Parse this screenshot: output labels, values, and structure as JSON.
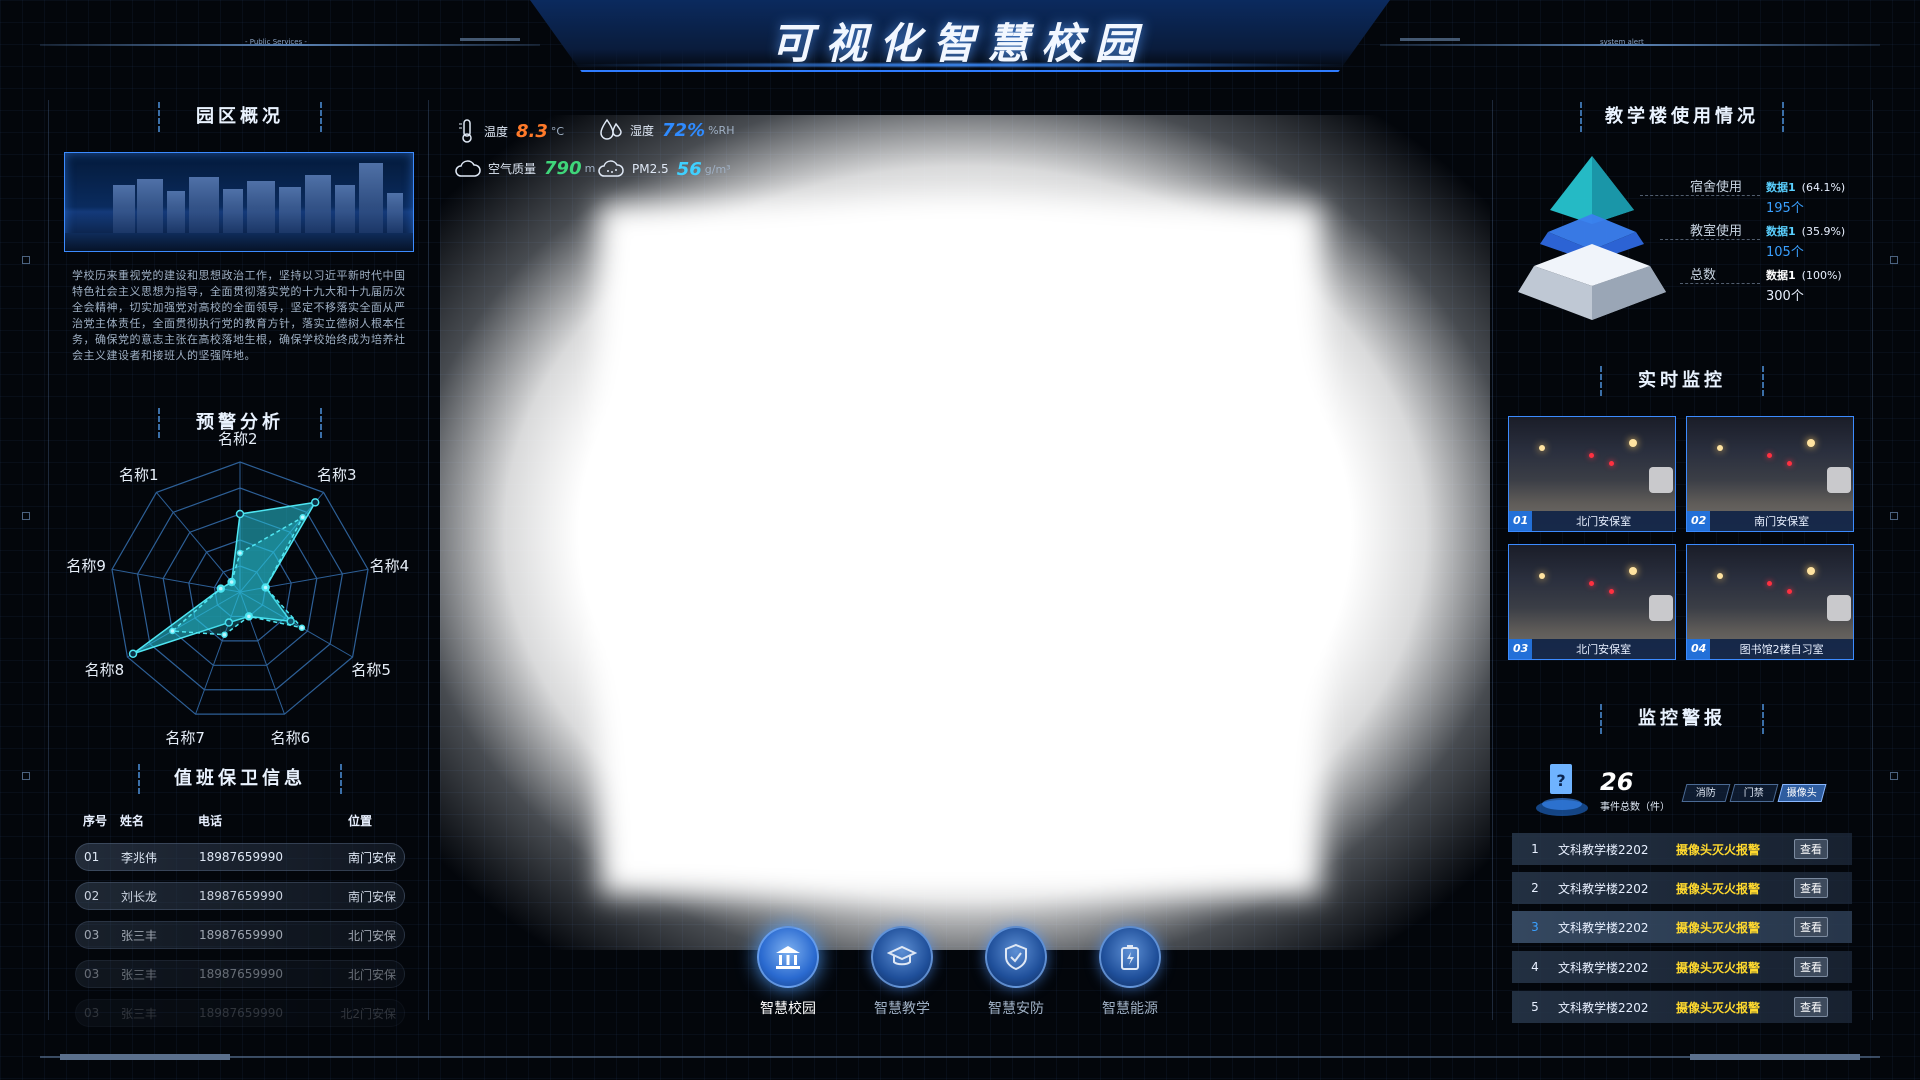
{
  "header": {
    "title": "可视化智慧校园",
    "deco_left": "- Public Services -",
    "deco_right": "system alert"
  },
  "left": {
    "overview_title": "园区概况",
    "overview_text": "学校历来重视党的建设和思想政治工作，坚持以习近平新时代中国特色社会主义思想为指导，全面贯彻落实党的十九大和十九届历次全会精神，切实加强党对高校的全面领导，坚定不移落实全面从严治党主体责任，全面贯彻执行党的教育方针，落实立德树人根本任务，确保党的意志主张在高校落地生根，确保学校始终成为培养社会主义建设者和接班人的坚强阵地。",
    "warning_title": "预警分析",
    "radar": {
      "labels": [
        "名称1",
        "名称2",
        "名称3",
        "名称4",
        "名称5",
        "名称6",
        "名称7",
        "名称8",
        "名称9"
      ],
      "series": [
        {
          "values": [
            0.1,
            0.6,
            0.9,
            0.2,
            0.45,
            0.2,
            0.25,
            0.95,
            0.15
          ]
        },
        {
          "values": [
            0.1,
            0.3,
            0.75,
            0.2,
            0.55,
            0.2,
            0.35,
            0.6,
            0.15
          ]
        }
      ]
    },
    "duty_title": "值班保卫信息",
    "duty_headers": [
      "序号",
      "姓名",
      "电话",
      "位置"
    ],
    "duty_rows": [
      [
        "01",
        "李兆伟",
        "18987659990",
        "南门安保"
      ],
      [
        "02",
        "刘长龙",
        "18987659990",
        "南门安保"
      ],
      [
        "03",
        "张三丰",
        "18987659990",
        "北门安保"
      ],
      [
        "03",
        "张三丰",
        "18987659990",
        "北门安保"
      ],
      [
        "03",
        "张三丰",
        "18987659990",
        "北2门安保"
      ]
    ]
  },
  "weather": {
    "temp": {
      "label": "温度",
      "value": "8.3",
      "unit": "°C",
      "color": "#ff7a2a"
    },
    "humidity": {
      "label": "湿度",
      "value": "72%",
      "unit": "%RH",
      "color": "#2f8bff"
    },
    "air": {
      "label": "空气质量",
      "value": "790",
      "unit": "m",
      "color": "#3fd67a"
    },
    "pm": {
      "label": "PM2.5",
      "value": "56",
      "unit": "g/m³",
      "color": "#3fd0ff"
    }
  },
  "nav": [
    {
      "label": "智慧校园",
      "icon": "bank-icon",
      "active": true
    },
    {
      "label": "智慧教学",
      "icon": "graduation-cap-icon",
      "active": false
    },
    {
      "label": "智慧安防",
      "icon": "shield-check-icon",
      "active": false
    },
    {
      "label": "智慧能源",
      "icon": "battery-icon",
      "active": false
    }
  ],
  "right": {
    "building_title": "教学楼使用情况",
    "pyramid": [
      {
        "label": "宿舍使用",
        "tag": "数据1",
        "pct": "(64.1%)",
        "count": "195个"
      },
      {
        "label": "教室使用",
        "tag": "数据1",
        "pct": "(35.9%)",
        "count": "105个"
      },
      {
        "label": "总数",
        "tag": "数据1",
        "pct": "(100%)",
        "count": "300个"
      }
    ],
    "monitor_title": "实时监控",
    "cameras": [
      {
        "num": "01",
        "name": "北门安保室"
      },
      {
        "num": "02",
        "name": "南门安保室"
      },
      {
        "num": "03",
        "name": "北门安保室"
      },
      {
        "num": "04",
        "name": "图书馆2楼自习室"
      }
    ],
    "alarm_title": "监控警报",
    "alarm_total": "26",
    "alarm_total_label": "事件总数（件）",
    "alarm_tabs": [
      "消防",
      "门禁",
      "摄像头"
    ],
    "alarm_rows": [
      {
        "idx": "1",
        "loc": "文科教学楼2202",
        "type": "摄像头灭火报警",
        "btn": "查看"
      },
      {
        "idx": "2",
        "loc": "文科教学楼2202",
        "type": "摄像头灭火报警",
        "btn": "查看"
      },
      {
        "idx": "3",
        "loc": "文科教学楼2202",
        "type": "摄像头灭火报警",
        "btn": "查看"
      },
      {
        "idx": "4",
        "loc": "文科教学楼2202",
        "type": "摄像头灭火报警",
        "btn": "查看"
      },
      {
        "idx": "5",
        "loc": "文科教学楼2202",
        "type": "摄像头灭火报警",
        "btn": "查看"
      }
    ]
  }
}
